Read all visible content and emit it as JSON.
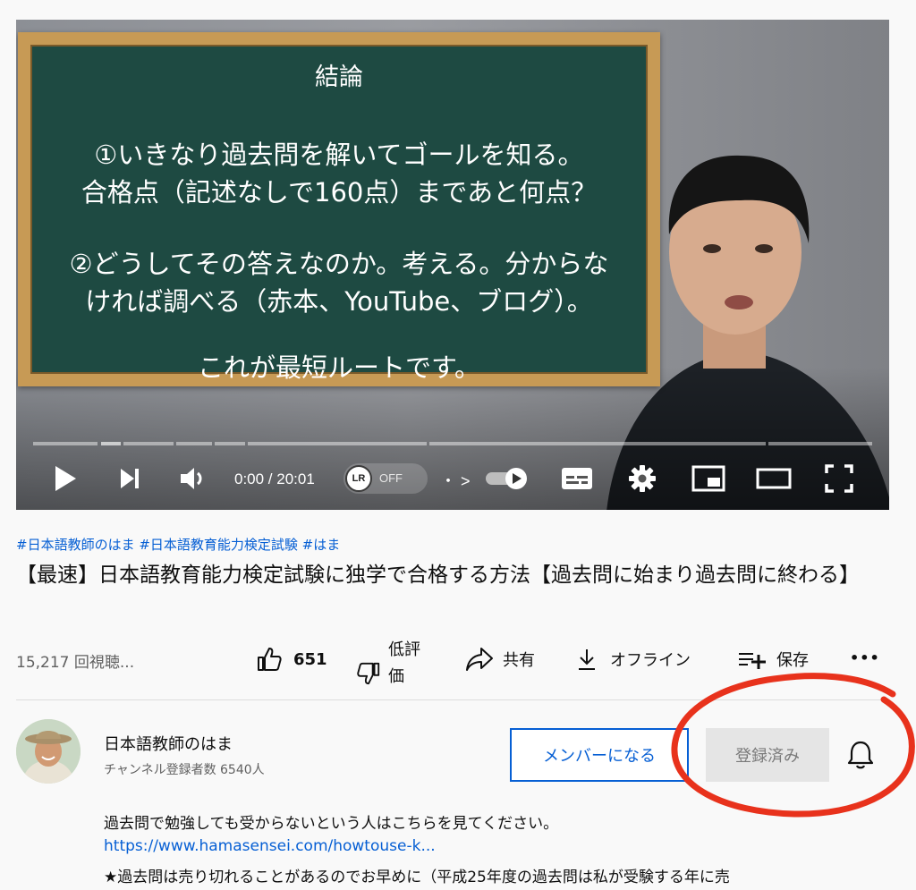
{
  "video": {
    "board": {
      "title": "結論",
      "line1": "①いきなり過去問を解いてゴールを知る。",
      "line2": "合格点（記述なしで160点）まであと何点？",
      "line3": "②どうしてその答えなのか。考える。分からな",
      "line4": "ければ調べる（赤本、YouTube、ブログ）。",
      "line5": "これが最短ルートです。"
    },
    "controls": {
      "time": "0:00 / 20:01",
      "lr_logo": "LR",
      "lr_toggle_state": "OFF",
      "chapter_separator": "・ >"
    }
  },
  "meta": {
    "hashtags": "#日本語教師のはま #日本語教育能力検定試験 #はま",
    "title": "【最速】日本語教育能力検定試験に独学で合格する方法【過去問に始まり過去問に終わる】",
    "views": "15,217 回視聴..."
  },
  "actions": {
    "like_count": "651",
    "dislike_label_1": "低評",
    "dislike_label_2": "価",
    "share_label": "共有",
    "offline_label": "オフライン",
    "save_label": "保存",
    "more_label": "•••"
  },
  "channel": {
    "name": "日本語教師のはま",
    "subscribers": "チャンネル登録者数 6540人",
    "member_button": "メンバーになる",
    "subscribed_button": "登録済み"
  },
  "description": {
    "line1": "過去問で勉強しても受からないという人はこちらを見てください。",
    "link": "https://www.hamasensei.com/howtouse-k...",
    "line3": "★過去問は売り切れることがあるのでお早めに（平成25年度の過去問は私が受験する年に売"
  },
  "colors": {
    "link_blue": "#065fd4",
    "annotation_red": "#e8321c",
    "chalkboard": "#1e4a42",
    "board_frame": "#c79a55"
  }
}
